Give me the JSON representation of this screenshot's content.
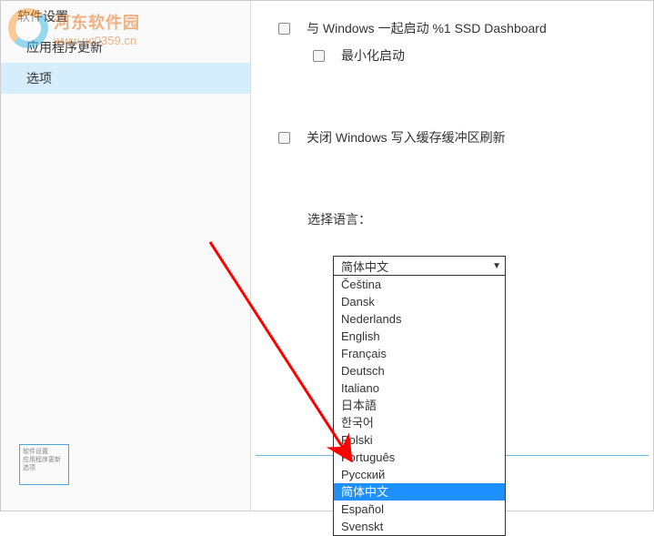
{
  "watermark": {
    "title": "河东软件园",
    "url": "www.pc0359.cn"
  },
  "sidebar": {
    "items": [
      {
        "label": "软件设置"
      },
      {
        "label": "应用程序更新"
      },
      {
        "label": "选项"
      }
    ]
  },
  "main": {
    "opt_startup": "与 Windows 一起启动 %1 SSD Dashboard",
    "opt_minimize": "最小化启动",
    "opt_cache": "关闭 Windows 写入缓存缓冲区刷新",
    "select_label": "选择语言：",
    "select_value": "简体中文",
    "dropdown": [
      "Čeština",
      "Dansk",
      "Nederlands",
      "English",
      "Français",
      "Deutsch",
      "Italiano",
      "日本語",
      "한국어",
      "Polski",
      "Português",
      "Русский",
      "简体中文",
      "Español",
      "Svenskt"
    ],
    "highlighted_index": 12
  },
  "thumb": {
    "l1": "软件设置",
    "l2": "应用程序更新",
    "l3": "选项"
  }
}
